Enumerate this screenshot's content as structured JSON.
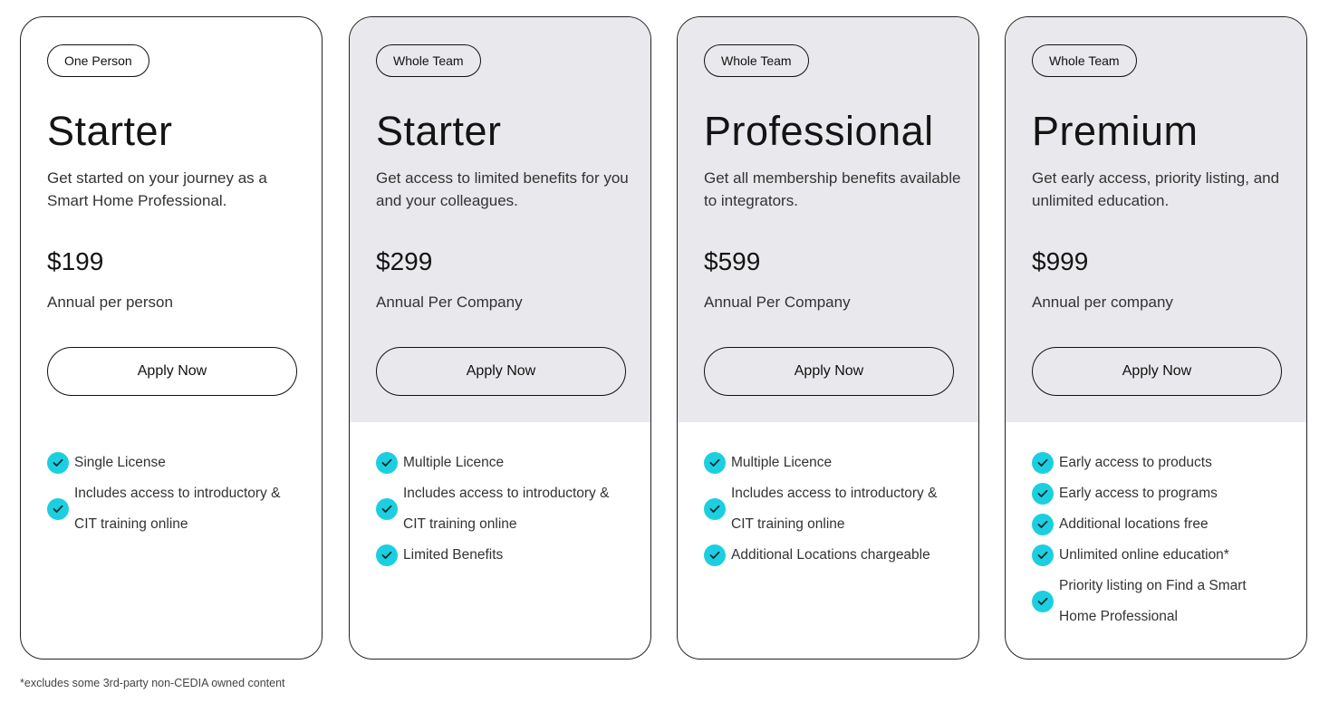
{
  "plans": [
    {
      "badge": "One Person",
      "title": "Starter",
      "description": "Get started on your journey as a Smart Home Professional.",
      "price": "$199",
      "period": "Annual per person",
      "button": "Apply Now",
      "features": [
        "Single License",
        "Includes access to introductory & CIT training online"
      ]
    },
    {
      "badge": "Whole Team",
      "title": "Starter",
      "description": "Get access to limited benefits for you and your colleagues.",
      "price": "$299",
      "period": "Annual Per Company",
      "button": "Apply Now",
      "features": [
        "Multiple Licence",
        "Includes access to introductory & CIT training online",
        "Limited Benefits"
      ]
    },
    {
      "badge": "Whole Team",
      "title": "Professional",
      "description": "Get all membership benefits available to integrators.",
      "price": "$599",
      "period": "Annual Per Company",
      "button": "Apply Now",
      "features": [
        "Multiple Licence",
        "Includes access to introductory & CIT training online",
        "Additional Locations chargeable"
      ]
    },
    {
      "badge": "Whole Team",
      "title": "Premium",
      "description": "Get early access, priority listing, and unlimited education.",
      "price": "$999",
      "period": "Annual per company",
      "button": "Apply Now",
      "features": [
        "Early access to products",
        "Early access to programs",
        "Additional locations free",
        "Unlimited online education*",
        "Priority listing on Find a Smart Home Professional"
      ]
    }
  ],
  "footnote": "*excludes some 3rd-party non-CEDIA owned content",
  "colors": {
    "check": "#1ccfe0",
    "shaded_header": "#e9e8ec",
    "border": "#222222"
  },
  "icons": {
    "feature": "check-circle-icon"
  }
}
